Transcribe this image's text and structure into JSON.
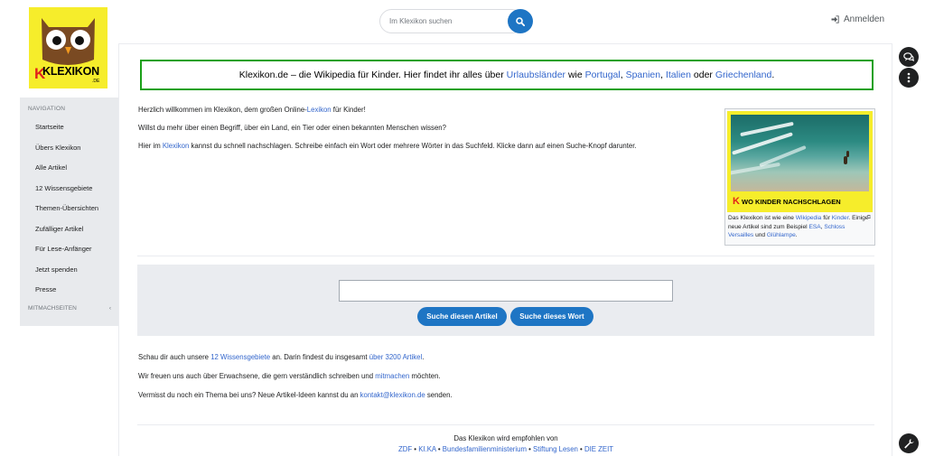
{
  "header": {
    "logo_text": "KLEXIKON",
    "logo_sub": ".DE",
    "search_placeholder": "Im Klexikon suchen",
    "login_label": "Anmelden"
  },
  "sidebar": {
    "heading": "NAVIGATION",
    "items": [
      {
        "label": "Startseite"
      },
      {
        "label": "Übers Klexikon"
      },
      {
        "label": "Alle Artikel"
      },
      {
        "label": "12 Wissensgebiete"
      },
      {
        "label": "Themen-Übersichten"
      },
      {
        "label": "Zufälliger Artikel"
      },
      {
        "label": "Für Lese-Anfänger"
      },
      {
        "label": "Jetzt spenden"
      },
      {
        "label": "Presse"
      }
    ],
    "heading2": "MITMACHSEITEN"
  },
  "banner": {
    "text1": "Klexikon.de – die Wikipedia für Kinder. Hier findet ihr alles über ",
    "link1": "Urlaubsländer",
    "text2": " wie ",
    "link2": "Portugal",
    "text3": ", ",
    "link3": "Spanien",
    "text4": ", ",
    "link4": "Italien",
    "text5": " oder ",
    "link5": "Griechenland",
    "text6": "."
  },
  "intro": {
    "p1_a": "Herzlich willkommen im Klexikon, dem großen Online-",
    "p1_link": "Lexikon",
    "p1_b": " für Kinder!",
    "p2": "Willst du mehr über einen Begriff, über ein Land, ein Tier oder einen bekannten Menschen wissen?",
    "p3_a": "Hier im ",
    "p3_link": "Klexikon",
    "p3_b": " kannst du schnell nachschlagen. Schreibe einfach ein Wort oder mehrere Wörter in das Suchfeld. Klicke dann auf einen Suche-Knopf darunter."
  },
  "thumb": {
    "banner_text": "WO KINDER NACHSCHLAGEN",
    "banner_k": "K",
    "cap_a": "Das Klexikon ist wie eine ",
    "cap_link1": "Wikipedia",
    "cap_b": " für ",
    "cap_link2": "Kinder",
    "cap_c": ". Einige neue Artikel sind zum Beispiel ",
    "cap_link3": "ESA",
    "cap_d": ", ",
    "cap_link4": "Schloss Versailles",
    "cap_e": " und ",
    "cap_link5": "Glühlampe",
    "cap_f": "."
  },
  "search_panel": {
    "button1": "Suche diesen Artikel",
    "button2": "Suche dieses Wort"
  },
  "bottom": {
    "p1_a": "Schau dir auch unsere ",
    "p1_link1": "12 Wissensgebiete",
    "p1_b": " an. Darin findest du insgesamt ",
    "p1_link2": "über 3200 Artikel",
    "p1_c": ".",
    "p2_a": "Wir freuen uns auch über Erwachsene, die gern verständlich schreiben und ",
    "p2_link": "mitmachen",
    "p2_b": " möchten.",
    "p3_a": "Vermisst du noch ein Thema bei uns? Neue Artikel-Ideen kannst du an ",
    "p3_link": "kontakt@klexikon.de",
    "p3_b": " senden."
  },
  "footer": {
    "line1": "Das Klexikon wird empfohlen von",
    "links": [
      "ZDF",
      "KI.KA",
      "Bundesfamilienministerium",
      "Stiftung Lesen",
      "DIE ZEIT"
    ],
    "sep": " • "
  },
  "colors": {
    "accent": "#1e75c4",
    "logo_yellow": "#f6ed2b",
    "banner_border": "#1aa018",
    "link": "#3366cc"
  }
}
